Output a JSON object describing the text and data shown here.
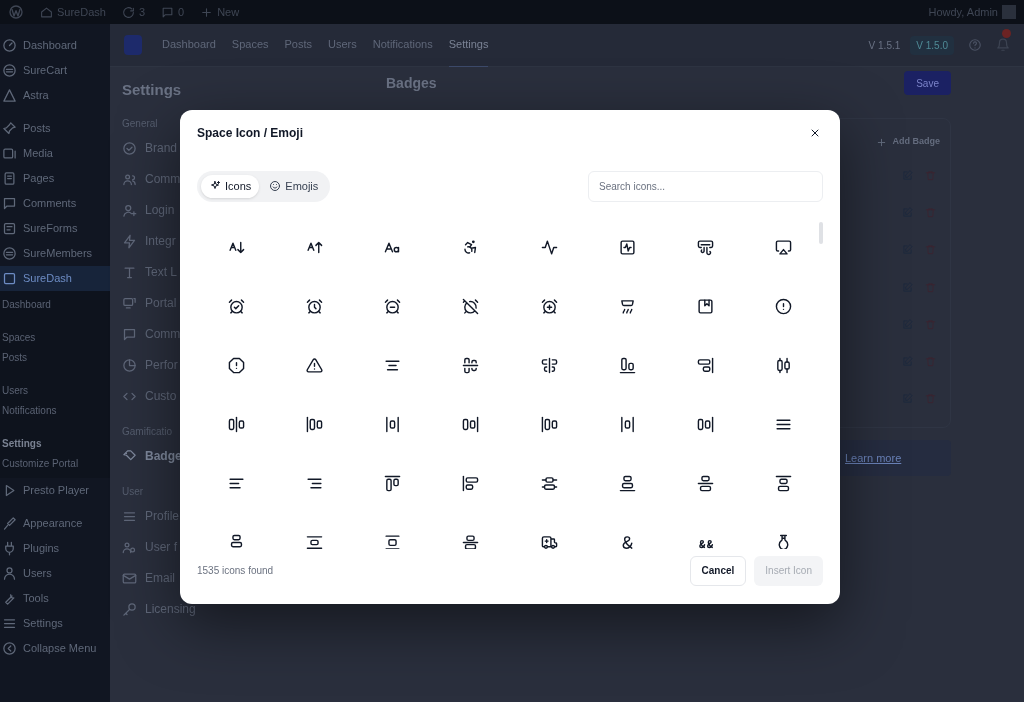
{
  "admin_bar": {
    "site": "SureDash",
    "updates": "3",
    "comments": "0",
    "new": "New",
    "greeting": "Howdy, Admin"
  },
  "wp_menu": [
    {
      "items": [
        {
          "label": "Dashboard",
          "selected": false
        },
        {
          "label": "SureCart",
          "selected": false
        },
        {
          "label": "Astra",
          "selected": false
        }
      ]
    },
    {
      "items": [
        {
          "label": "Posts",
          "selected": false
        },
        {
          "label": "Media",
          "selected": false
        },
        {
          "label": "Pages",
          "selected": false
        },
        {
          "label": "Comments",
          "selected": false
        },
        {
          "label": "SureForms",
          "selected": false
        },
        {
          "label": "SureMembers",
          "selected": false
        },
        {
          "label": "SureDash",
          "selected": true,
          "children": [
            {
              "items": [
                {
                  "label": "Dashboard",
                  "selected": false
                }
              ]
            },
            {
              "items": [
                {
                  "label": "Spaces",
                  "selected": false
                },
                {
                  "label": "Posts",
                  "selected": false
                }
              ]
            },
            {
              "items": [
                {
                  "label": "Users",
                  "selected": false
                },
                {
                  "label": "Notifications",
                  "selected": false
                }
              ]
            },
            {
              "items": [
                {
                  "label": "Settings",
                  "selected": true
                },
                {
                  "label": "Customize Portal",
                  "selected": false
                }
              ]
            }
          ]
        },
        {
          "label": "Presto Player",
          "selected": false
        }
      ]
    },
    {
      "items": [
        {
          "label": "Appearance",
          "selected": false
        },
        {
          "label": "Plugins",
          "selected": false
        },
        {
          "label": "Users",
          "selected": false
        },
        {
          "label": "Tools",
          "selected": false
        },
        {
          "label": "Settings",
          "selected": false
        },
        {
          "label": "Collapse Menu",
          "selected": false
        }
      ]
    }
  ],
  "top_nav": {
    "tabs": [
      {
        "label": "Dashboard",
        "selected": false
      },
      {
        "label": "Spaces",
        "selected": false
      },
      {
        "label": "Posts",
        "selected": false
      },
      {
        "label": "Users",
        "selected": false
      },
      {
        "label": "Notifications",
        "selected": false
      },
      {
        "label": "Settings",
        "selected": true
      }
    ],
    "versions": [
      "V 1.5.1",
      "V 1.5.0"
    ]
  },
  "settings": {
    "title": "Settings",
    "sections": [
      {
        "title": "General",
        "items": [
          {
            "label": "Brand",
            "selected": false
          },
          {
            "label": "Comm",
            "selected": false
          },
          {
            "label": "Login",
            "selected": false
          },
          {
            "label": "Integr",
            "selected": false
          },
          {
            "label": "Text L",
            "selected": false
          },
          {
            "label": "Portal",
            "selected": false
          },
          {
            "label": "Comm",
            "selected": false
          },
          {
            "label": "Perfor",
            "selected": false
          },
          {
            "label": "Custo",
            "selected": false
          }
        ]
      },
      {
        "title": "Gamificatio",
        "items": [
          {
            "label": "Badge",
            "selected": true
          }
        ]
      },
      {
        "title": "User",
        "items": [
          {
            "label": "Profile",
            "selected": false
          },
          {
            "label": "User f",
            "selected": false
          },
          {
            "label": "Email",
            "selected": false
          },
          {
            "label": "Licensing",
            "selected": false
          }
        ]
      }
    ]
  },
  "badges": {
    "title": "Badges",
    "save": "Save",
    "add": "Add Badge",
    "learn_more": "Learn more"
  },
  "modal": {
    "title": "Space Icon / Emoji",
    "tabs": [
      {
        "label": "Icons",
        "selected": true
      },
      {
        "label": "Emojis",
        "selected": false
      }
    ],
    "search": {
      "placeholder": "Search icons..."
    },
    "count": "1535 icons found",
    "cancel": "Cancel",
    "insert": {
      "label": "Insert Icon",
      "disabled": true
    }
  }
}
